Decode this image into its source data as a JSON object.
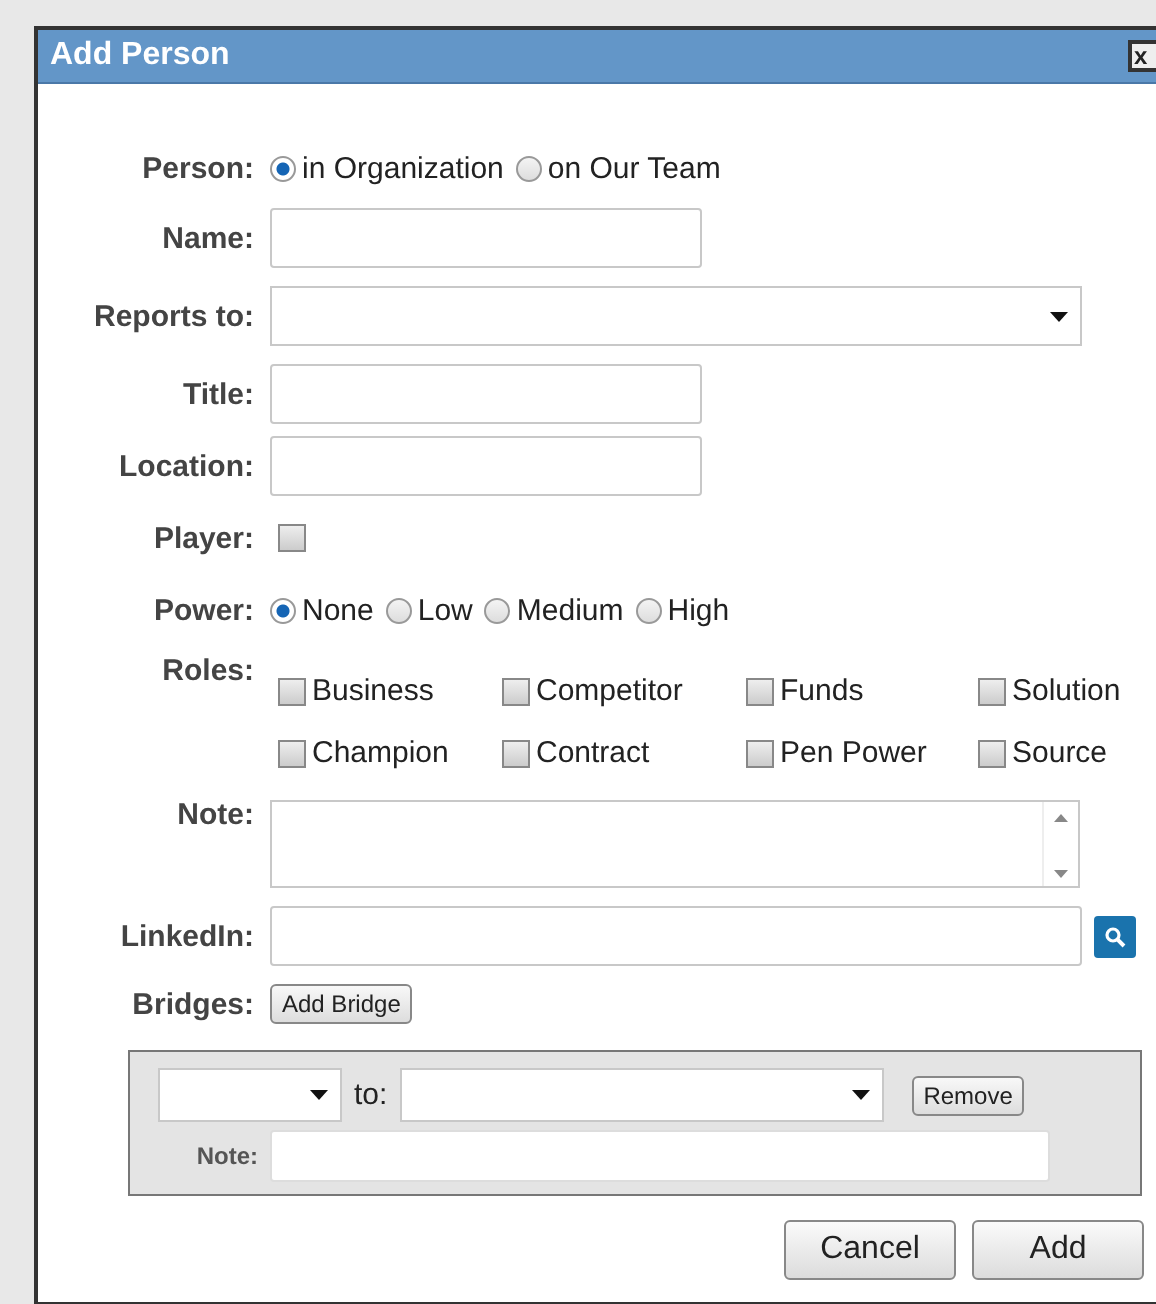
{
  "window": {
    "title": "Add Person",
    "close": "x"
  },
  "person": {
    "label": "Person:",
    "options": [
      {
        "label": "in Organization",
        "selected": true
      },
      {
        "label": "on Our Team",
        "selected": false
      }
    ]
  },
  "name": {
    "label": "Name:"
  },
  "reports_to": {
    "label": "Reports to:"
  },
  "title": {
    "label": "Title:"
  },
  "location": {
    "label": "Location:"
  },
  "player": {
    "label": "Player:",
    "checked": false
  },
  "power": {
    "label": "Power:",
    "options": [
      {
        "label": "None",
        "selected": true
      },
      {
        "label": "Low",
        "selected": false
      },
      {
        "label": "Medium",
        "selected": false
      },
      {
        "label": "High",
        "selected": false
      }
    ]
  },
  "roles": {
    "label": "Roles:",
    "items": [
      {
        "label": "Business",
        "checked": false
      },
      {
        "label": "Competitor",
        "checked": false
      },
      {
        "label": "Funds",
        "checked": false
      },
      {
        "label": "Solution",
        "checked": false
      },
      {
        "label": "Champion",
        "checked": false
      },
      {
        "label": "Contract",
        "checked": false
      },
      {
        "label": "Pen Power",
        "checked": false
      },
      {
        "label": "Source",
        "checked": false
      }
    ]
  },
  "note": {
    "label": "Note:"
  },
  "linkedin": {
    "label": "LinkedIn:"
  },
  "bridges": {
    "label": "Bridges:",
    "add_button": "Add Bridge",
    "to_label": "to:",
    "remove_button": "Remove",
    "note_label": "Note:"
  },
  "buttons": [
    "Cancel",
    "Add"
  ]
}
